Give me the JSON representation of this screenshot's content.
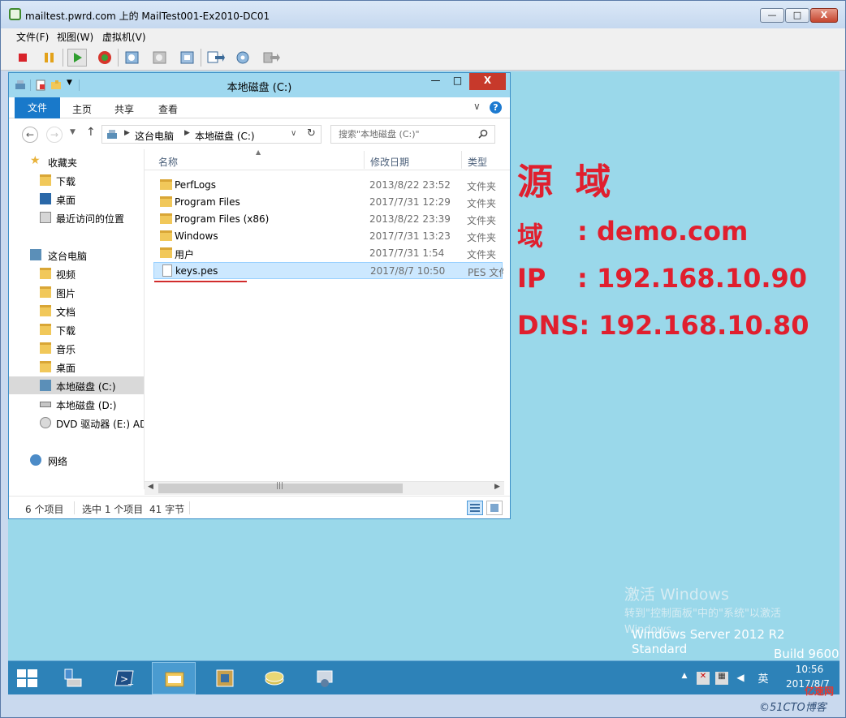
{
  "vm_window": {
    "title": "mailtest.pwrd.com 上的 MailTest001-Ex2010-DC01",
    "controls": {
      "minimize": "—",
      "maximize": "□",
      "close": "X"
    },
    "menu": [
      "文件(F)",
      "视图(W)",
      "虚拟机(V)"
    ],
    "toolbar_icons": [
      "stop-icon",
      "pause-icon",
      "play-icon",
      "reset-icon",
      "snapshot-icon",
      "revert-icon",
      "snapshot-manager-icon",
      "connect-icon",
      "settings-icon",
      "tools-icon"
    ]
  },
  "explorer": {
    "title": "本地磁盘 (C:)",
    "controls": {
      "minimize": "—",
      "maximize": "□",
      "close": "X"
    },
    "ribbon": {
      "tabs": [
        "文件",
        "主页",
        "共享",
        "查看"
      ],
      "expand": "∨",
      "help": "?"
    },
    "address": {
      "crumbs": [
        "这台电脑",
        "本地磁盘 (C:)"
      ],
      "search_placeholder": "搜索\"本地磁盘 (C:)\""
    },
    "nav": {
      "favorites": {
        "label": "收藏夹",
        "items": [
          "下载",
          "桌面",
          "最近访问的位置"
        ]
      },
      "this_pc": {
        "label": "这台电脑",
        "items": [
          "视频",
          "图片",
          "文档",
          "下载",
          "音乐",
          "桌面",
          "本地磁盘 (C:)",
          "本地磁盘 (D:)",
          "DVD 驱动器 (E:) AD"
        ]
      },
      "network": {
        "label": "网络"
      },
      "selected": "本地磁盘 (C:)"
    },
    "columns": {
      "name": "名称",
      "date": "修改日期",
      "type": "类型"
    },
    "files": [
      {
        "name": "PerfLogs",
        "date": "2013/8/22 23:52",
        "type": "文件夹",
        "kind": "folder"
      },
      {
        "name": "Program Files",
        "date": "2017/7/31 12:29",
        "type": "文件夹",
        "kind": "folder"
      },
      {
        "name": "Program Files (x86)",
        "date": "2013/8/22 23:39",
        "type": "文件夹",
        "kind": "folder"
      },
      {
        "name": "Windows",
        "date": "2017/7/31 13:23",
        "type": "文件夹",
        "kind": "folder"
      },
      {
        "name": "用户",
        "date": "2017/7/31 1:54",
        "type": "文件夹",
        "kind": "folder"
      },
      {
        "name": "keys.pes",
        "date": "2017/8/7 10:50",
        "type": "PES 文件",
        "kind": "file",
        "selected": true
      }
    ],
    "status": {
      "items": "6 个项目",
      "selected": "选中 1 个项目",
      "size": "41 字节"
    }
  },
  "annotation": {
    "title": "源 域",
    "domain_label": "域",
    "domain_value": ": demo.com",
    "ip_label": "IP",
    "ip_value": ": 192.168.10.90",
    "dns": "DNS: 192.168.10.80",
    "color": "#e01f2e"
  },
  "desktop": {
    "activation_title": "激活 Windows",
    "activation_desc": "转到\"控制面板\"中的\"系统\"以激活",
    "activation_windows": "Windows。",
    "os_edition": "Windows Server 2012 R2 Standard",
    "os_build": "Build 9600"
  },
  "taskbar": {
    "apps": [
      "server-manager-icon",
      "powershell-icon",
      "file-explorer-icon",
      "ad-tool-icon",
      "dns-icon",
      "setup-icon"
    ],
    "tray": {
      "language": "英",
      "time": "10:56",
      "date": "2017/8/7"
    }
  },
  "watermark": {
    "site": "©51CTO博客",
    "cn": "亿速网"
  }
}
